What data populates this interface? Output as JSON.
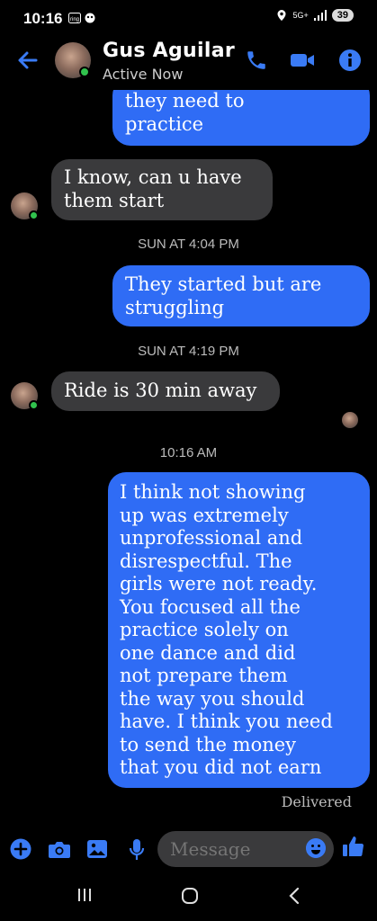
{
  "status_bar": {
    "time": "10:16",
    "network": "5G+",
    "battery": "39"
  },
  "header": {
    "contact_name": "Gus Aguilar",
    "status": "Active Now"
  },
  "messages": [
    {
      "side": "out",
      "lines": [
        "they need to",
        "practice"
      ]
    },
    {
      "side": "in",
      "lines": [
        "I know,  can u have",
        "them start"
      ]
    },
    {
      "side": "timestamp",
      "text": "SUN AT 4:04 PM"
    },
    {
      "side": "out",
      "lines": [
        "They started but are",
        "struggling"
      ]
    },
    {
      "side": "timestamp",
      "text": "SUN AT 4:19 PM"
    },
    {
      "side": "in",
      "lines": [
        "Ride is 30 min away"
      ]
    },
    {
      "side": "timestamp",
      "text": "10:16 AM"
    },
    {
      "side": "out",
      "lines": [
        "I think not showing",
        "up was extremely",
        "unprofessional and",
        "disrespectful.  The",
        "girls were not ready.",
        "You focused all the",
        "practice solely on",
        "one dance and did",
        "not prepare them",
        "the way you should",
        "have. I think you need",
        "to send the money",
        "that you did not earn"
      ]
    }
  ],
  "delivery_status": "Delivered",
  "composer": {
    "placeholder": "Message"
  },
  "colors": {
    "accent": "#2f6cf5",
    "incoming_bubble": "#3a3a3c",
    "online": "#31c24d",
    "background": "#000000"
  }
}
